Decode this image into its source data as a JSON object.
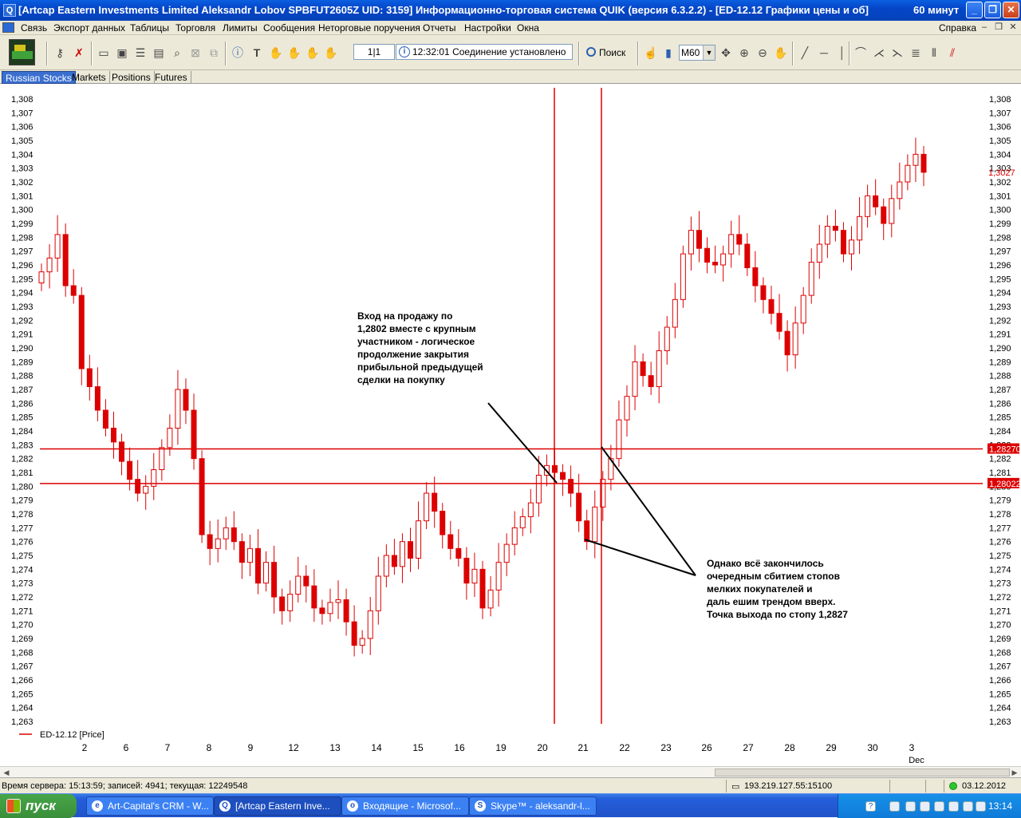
{
  "window": {
    "title": "[Artcap Eastern Investments Limited Aleksandr Lobov SPBFUT2605Z  UID: 3159] Информационно-торговая система QUIK (версия 6.3.2.2) - [ED-12.12 Графики цены и об]",
    "interval_label": "60 минут",
    "controls": {
      "minimize": "_",
      "maximize": "❐",
      "close": "✕"
    }
  },
  "menu": {
    "items": [
      "Связь",
      "Экспорт данных",
      "Таблицы",
      "Торговля",
      "Лимиты",
      "Сообщения",
      "Неторговые поручения",
      "Отчеты",
      "Настройки",
      "Окна"
    ],
    "help": "Справка"
  },
  "toolbar": {
    "page": "1|1",
    "connection_time": "12:32:01",
    "connection_status": "Соединение установлено",
    "search_label": "Поиск",
    "interval_select": "M60"
  },
  "tabs": [
    "Russian Stocks",
    "Markets",
    "Positions",
    "Futures"
  ],
  "chart_data": {
    "type": "candlestick",
    "title": "",
    "legend": "ED-12.12 [Price]",
    "x_categories": [
      "2",
      "6",
      "7",
      "8",
      "9",
      "12",
      "13",
      "14",
      "15",
      "16",
      "19",
      "20",
      "21",
      "22",
      "23",
      "26",
      "27",
      "28",
      "29",
      "30",
      "3"
    ],
    "x_secondary_label": "Dec",
    "ylim": [
      1.263,
      1.308
    ],
    "y_ticks": [
      "1,308",
      "1,307",
      "1,306",
      "1,305",
      "1,304",
      "1,303",
      "1,302",
      "1,301",
      "1,300",
      "1,299",
      "1,298",
      "1,297",
      "1,296",
      "1,295",
      "1,294",
      "1,293",
      "1,292",
      "1,291",
      "1,290",
      "1,289",
      "1,288",
      "1,287",
      "1,286",
      "1,285",
      "1,284",
      "1,283",
      "1,282",
      "1,281",
      "1,280",
      "1,279",
      "1,278",
      "1,277",
      "1,276",
      "1,275",
      "1,274",
      "1,273",
      "1,272",
      "1,271",
      "1,270",
      "1,269",
      "1,268",
      "1,267",
      "1,266",
      "1,265",
      "1,264",
      "1,263"
    ],
    "series_closes": [
      1.2955,
      1.2965,
      1.2982,
      1.2945,
      1.2938,
      1.2885,
      1.2872,
      1.2855,
      1.2842,
      1.2832,
      1.2818,
      1.2805,
      1.2795,
      1.28,
      1.2812,
      1.2828,
      1.2842,
      1.287,
      1.2855,
      1.282,
      1.2765,
      1.2755,
      1.2762,
      1.277,
      1.276,
      1.2745,
      1.2755,
      1.273,
      1.2745,
      1.272,
      1.271,
      1.2722,
      1.2735,
      1.2728,
      1.2712,
      1.2708,
      1.2716,
      1.2718,
      1.2702,
      1.2685,
      1.269,
      1.271,
      1.2735,
      1.275,
      1.2742,
      1.276,
      1.2748,
      1.2775,
      1.2795,
      1.2782,
      1.2765,
      1.2755,
      1.2748,
      1.273,
      1.274,
      1.2712,
      1.2725,
      1.2745,
      1.2758,
      1.277,
      1.2778,
      1.2788,
      1.2808,
      1.2815,
      1.281,
      1.2805,
      1.2795,
      1.2775,
      1.276,
      1.2785,
      1.2805,
      1.282,
      1.2848,
      1.2865,
      1.289,
      1.288,
      1.2872,
      1.2898,
      1.2915,
      1.2935,
      1.2968,
      1.2985,
      1.2972,
      1.2962,
      1.296,
      1.2968,
      1.2982,
      1.2975,
      1.2958,
      1.2945,
      1.2935,
      1.2925,
      1.2912,
      1.2895,
      1.2918,
      1.2938,
      1.2962,
      1.2975,
      1.2988,
      1.2985,
      1.2968,
      1.2978,
      1.2995,
      1.301,
      1.3002,
      1.299,
      1.3008,
      1.302,
      1.3032,
      1.304,
      1.3027
    ],
    "price_label_current": "1,3027",
    "horizontal_levels": [
      {
        "value": 1.2827,
        "label": "1,28270"
      },
      {
        "value": 1.2802,
        "label": "1,28022"
      }
    ],
    "colors": {
      "candle": "#dd0000",
      "level_line": "#dd0000",
      "annotation": "#000000"
    }
  },
  "annotations": {
    "entry_text": [
      "Вход на продажу по",
      "1,2802 вместе с крупным",
      "участником - логическое",
      "продолжение закрытия",
      "прибыльной предыдущей",
      "сделки на покупку"
    ],
    "exit_text": [
      "Однако всё закончилось",
      "очередным сбитием стопов",
      "мелких покупателей и",
      "даль  ешим трендом вверх.",
      "Точка выхода по стопу 1,2827"
    ]
  },
  "status": {
    "server_time": "Время сервера: 15:13:59; записей: 4941; текущая: 12249548",
    "server_address": "193.219.127.55:15100",
    "date": "03.12.2012"
  },
  "taskbar": {
    "start_label": "пуск",
    "tasks": [
      "Art-Capital's CRM - W...",
      "[Artcap Eastern Inve...",
      "Входящие - Microsof...",
      "Skype™ - aleksandr-l..."
    ],
    "lang": "EN",
    "clock": "13:14"
  }
}
